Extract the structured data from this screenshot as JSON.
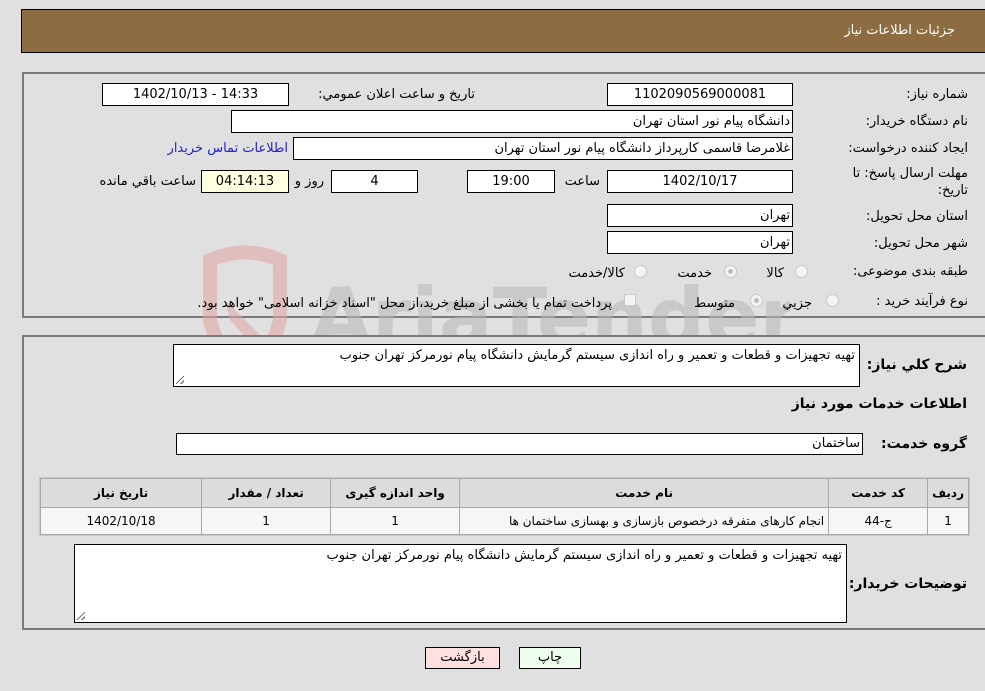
{
  "header": {
    "title": "جزئیات اطلاعات نیاز"
  },
  "details": {
    "need_number": {
      "label": "شماره نیاز:",
      "value": "1102090569000081"
    },
    "announce_datetime": {
      "label": "تاریخ و ساعت اعلان عمومي:",
      "value": "1402/10/13 - 14:33"
    },
    "buyer_org": {
      "label": "نام دستگاه خریدار:",
      "value": "دانشگاه پیام نور استان تهران"
    },
    "requester": {
      "label": "ایجاد کننده درخواست:",
      "value": "غلامرضا قاسمی کارپرداز دانشگاه پیام نور استان تهران"
    },
    "buyer_contact_link": "اطلاعات تماس خریدار",
    "deadline": {
      "label_line1": "مهلت ارسال پاسخ: تا",
      "label_line2": "تاریخ:",
      "date": "1402/10/17",
      "time_label": "ساعت",
      "time": "19:00",
      "days": "4",
      "days_label": "روز و",
      "remaining": "04:14:13",
      "remaining_label": "ساعت باقي مانده"
    },
    "delivery_province": {
      "label": "استان محل تحویل:",
      "value": "تهران"
    },
    "delivery_city": {
      "label": "شهر محل تحویل:",
      "value": "تهران"
    },
    "category": {
      "label": "طبقه بندی موضوعی:",
      "options": [
        "کالا",
        "خدمت",
        "کالا/خدمت"
      ],
      "selected": "خدمت"
    },
    "purchase_type": {
      "label": "نوع فرآیند خرید :",
      "options": [
        "جزيي",
        "متوسط"
      ],
      "selected": "متوسط",
      "treasury_note": "پرداخت تمام یا بخشی از مبلغ خرید،از محل \"اسناد خزانه اسلامی\" خواهد بود."
    }
  },
  "summary": {
    "label": "شرح كلي نياز:",
    "value": "تهیه تجهیزات و قطعات و تعمیر و راه اندازی  سیستم گرمایش دانشگاه پیام نورمرکز تهران جنوب"
  },
  "services_section_title": "اطلاعات خدمات مورد نیاز",
  "service_group": {
    "label": "گروه خدمت:",
    "value": "ساختمان"
  },
  "table": {
    "headers": [
      "ردیف",
      "کد خدمت",
      "نام خدمت",
      "واحد اندازه گیری",
      "تعداد / مقدار",
      "تاریخ نیاز"
    ],
    "rows": [
      [
        "1",
        "ج-44",
        "انجام کارهای متفرقه درخصوص بازسازی و بهسازی ساختمان ها",
        "1",
        "1",
        "1402/10/18"
      ]
    ]
  },
  "buyer_notes": {
    "label": "توضیحات خریدار:",
    "value": "تهیه تجهیزات و قطعات و تعمیر و راه اندازی  سیستم گرمایش دانشگاه پیام نورمرکز تهران جنوب"
  },
  "buttons": {
    "print": "چاپ",
    "back": "بازگشت"
  },
  "watermark": {
    "text": "AriaTender.neT"
  },
  "colors": {
    "header_bg": "#8d6c41",
    "print_bg": "#eeffee",
    "back_bg": "#ffe0e0",
    "link": "#2222cc"
  }
}
